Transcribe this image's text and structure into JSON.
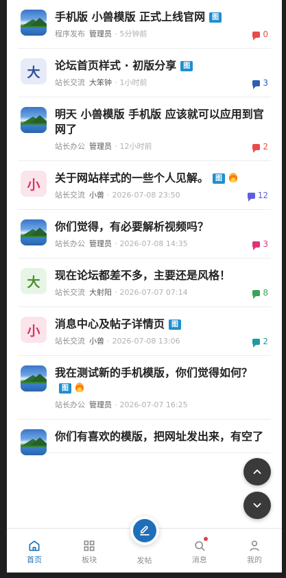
{
  "posts": [
    {
      "title": "手机版 小兽模版 正式上线官网",
      "badge": "图",
      "forum": "程序发布",
      "author": "管理员",
      "time": "5分钟前",
      "replies": "0",
      "reply_color": "#e94a4a",
      "avatar": "photo",
      "hot": false
    },
    {
      "title": "论坛首页样式 · 初版分享",
      "badge": "图",
      "forum": "站长交流",
      "author": "大笨钟",
      "time": "1小时前",
      "replies": "3",
      "reply_color": "#2d5fb3",
      "avatar": "letter",
      "letter": "大",
      "avatar_theme": "blue",
      "hot": false
    },
    {
      "title": "明天 小兽模版 手机版 应该就可以应用到官网了",
      "badge": "",
      "forum": "站长办公",
      "author": "管理员",
      "time": "12小时前",
      "replies": "2",
      "reply_color": "#e94a4a",
      "avatar": "photo",
      "hot": false
    },
    {
      "title": "关于网站样式的一些个人见解。",
      "badge": "图",
      "forum": "站长交流",
      "author": "小兽",
      "time": "2026-07-08 23:50",
      "replies": "12",
      "reply_color": "#5c5fdc",
      "avatar": "letter",
      "letter": "小",
      "avatar_theme": "pink",
      "hot": true
    },
    {
      "title": "你们觉得，有必要解析视频吗？",
      "badge": "",
      "forum": "站长办公",
      "author": "管理员",
      "time": "2026-07-08 14:35",
      "replies": "3",
      "reply_color": "#e0327a",
      "avatar": "photo",
      "hot": false
    },
    {
      "title": "现在论坛都差不多，主要还是风格！",
      "badge": "",
      "forum": "站长交流",
      "author": "大射阳",
      "time": "2026-07-07 07:14",
      "replies": "8",
      "reply_color": "#3aa35b",
      "avatar": "letter",
      "letter": "大",
      "avatar_theme": "green",
      "hot": false
    },
    {
      "title": "消息中心及帖子详情页",
      "badge": "图",
      "forum": "站长交流",
      "author": "小兽",
      "time": "2026-07-08 13:06",
      "replies": "2",
      "reply_color": "#1e9aa0",
      "avatar": "letter",
      "letter": "小",
      "avatar_theme": "pink",
      "hot": false
    },
    {
      "title": "我在测试新的手机模版，你们觉得如何？",
      "badge": "图",
      "forum": "站长办公",
      "author": "管理员",
      "time": "2026-07-07 16:25",
      "replies": "",
      "reply_color": "#8e8e8e",
      "avatar": "photo",
      "hot": true
    },
    {
      "title": "你们有喜欢的模版，把网址发出来，有空了",
      "badge": "",
      "forum": "",
      "author": "",
      "time": "",
      "replies": "",
      "reply_color": "#8e8e8e",
      "avatar": "photo",
      "hot": false
    }
  ],
  "tabbar": {
    "home": "首页",
    "blocks": "板块",
    "post": "发帖",
    "messages": "消息",
    "me": "我的"
  },
  "colors": {
    "primary": "#1f6fb8",
    "badge": "#1f8fd0"
  },
  "icons": {
    "scroll_up": "chevron-up-icon",
    "scroll_down": "chevron-down-icon",
    "home": "home-icon",
    "blocks": "grid-icon",
    "post": "pen-icon",
    "messages": "search-icon",
    "me": "user-icon"
  }
}
